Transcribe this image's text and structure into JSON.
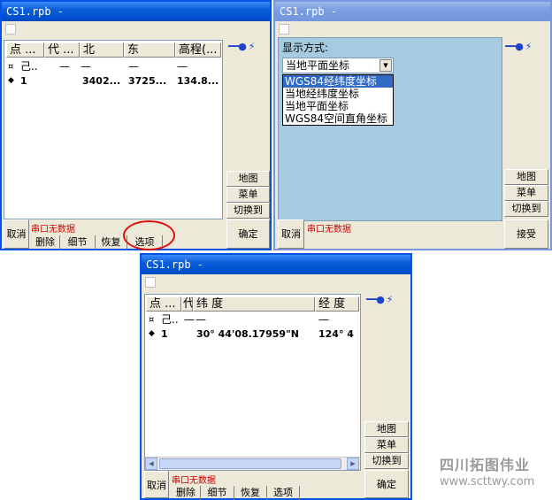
{
  "window1": {
    "title": "CS1.rpb -",
    "columns": [
      "点 ...",
      "代 ...",
      "北",
      "东",
      "高程(..."
    ],
    "rows": [
      {
        "marker": "¤",
        "c1": "己..",
        "c2": "—",
        "c3": "—",
        "c4": "—",
        "c5": "—"
      },
      {
        "marker": "◆",
        "c1": "1",
        "c2": "",
        "c3": "3402...",
        "c4": "3725...",
        "c5": "134.8..."
      }
    ],
    "buttons": {
      "map": "地图",
      "menu": "菜单",
      "switch": "切换到",
      "ok": "确定",
      "cancel": "取消"
    },
    "tabs": [
      "删除",
      "细节",
      "恢复",
      "选项"
    ],
    "status": "串口无数据",
    "highlight_color": "#e01010"
  },
  "window2": {
    "title": "CS1.rpb -",
    "display_label": "显示方式:",
    "select_value": "当地平面坐标",
    "options": [
      "WGS84经纬度坐标",
      "当地经纬度坐标",
      "当地平面坐标",
      "WGS84空间直角坐标"
    ],
    "buttons": {
      "map": "地图",
      "menu": "菜单",
      "switch": "切换到",
      "accept": "接受",
      "cancel": "取消"
    },
    "status": "串口无数据"
  },
  "window3": {
    "title": "CS1.rpb -",
    "columns": [
      "点 ...",
      "代",
      "纬 度",
      "经 度"
    ],
    "rows": [
      {
        "marker": "¤",
        "c1": "己..",
        "c2": "—",
        "c3": "—",
        "c4": "—"
      },
      {
        "marker": "◆",
        "c1": "1",
        "c2": "",
        "c3": "30° 44'08.17959\"N",
        "c4": "124° 4"
      }
    ],
    "buttons": {
      "map": "地图",
      "menu": "菜单",
      "switch": "切换到",
      "ok": "确定",
      "cancel": "取消"
    },
    "tabs": [
      "删除",
      "细节",
      "恢复",
      "选项"
    ],
    "status": "串口无数据"
  },
  "watermark": {
    "name": "四川拓图伟业",
    "url": "www.scttwy.com"
  }
}
